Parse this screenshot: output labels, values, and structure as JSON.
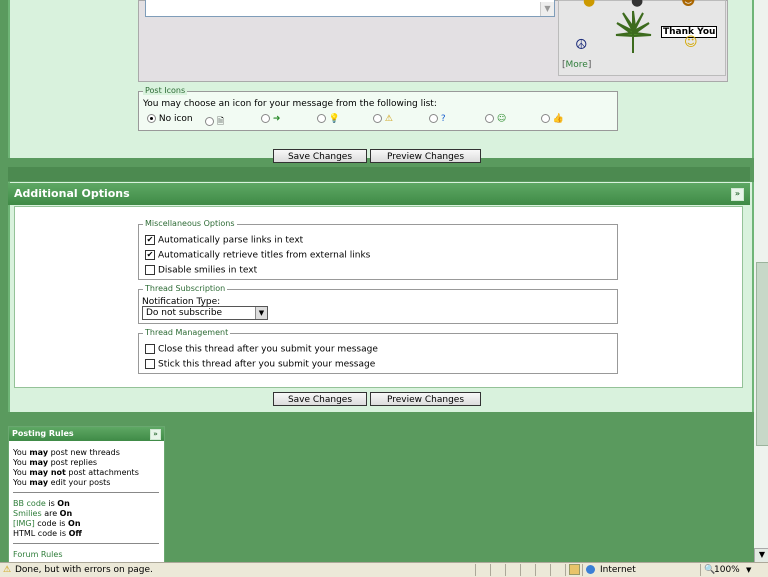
{
  "editor": {
    "textarea_scroll_glyph": "▼",
    "smilies": {
      "thank_you_label": "Thank You",
      "more_link": "More",
      "more_open": "[",
      "more_close": "]"
    }
  },
  "post_icons": {
    "legend": "Post Icons",
    "instruction": "You may choose an icon for your message from the following list:",
    "no_icon_label": "No icon",
    "icons": [
      "doc-icon",
      "arrow-right-icon",
      "lightbulb-icon",
      "warning-icon",
      "question-icon",
      "smile-icon",
      "thumbs-up-icon"
    ]
  },
  "buttons": {
    "save_changes": "Save Changes",
    "preview_changes": "Preview Changes"
  },
  "additional_options": {
    "title": "Additional Options",
    "collapse_glyph": "»",
    "misc": {
      "legend": "Miscellaneous Options",
      "parse_links": {
        "label": "Automatically parse links in text",
        "checked": true
      },
      "retrieve_titles": {
        "label": "Automatically retrieve titles from external links",
        "checked": true
      },
      "disable_smilies": {
        "label": "Disable smilies in text",
        "checked": false
      }
    },
    "subscription": {
      "legend": "Thread Subscription",
      "notification_label": "Notification Type:",
      "selected": "Do not subscribe"
    },
    "management": {
      "legend": "Thread Management",
      "close_thread": {
        "label": "Close this thread after you submit your message",
        "checked": false
      },
      "stick_thread": {
        "label": "Stick this thread after you submit your message",
        "checked": false
      }
    },
    "check_glyph": "✔"
  },
  "posting_rules": {
    "title": "Posting Rules",
    "collapse_glyph": "»",
    "you": "You",
    "may": "may",
    "may_not": "may not",
    "new_threads": "post new threads",
    "replies": "post replies",
    "attachments": "post attachments",
    "edit_posts": "edit your posts",
    "bb_code": "BB code",
    "smilies": "Smilies",
    "img": "[IMG]",
    "html": "HTML code",
    "is": "is",
    "are": "are",
    "code_is": "code is",
    "on": "On",
    "off": "Off",
    "forum_rules": "Forum Rules"
  },
  "status_bar": {
    "message": "Done, but with errors on page.",
    "zone": "Internet",
    "zoom": "100%",
    "warning_glyph": "⚠",
    "zoom_glyph": "▼"
  },
  "colors": {
    "accent": "#3f8a46",
    "panel_bg": "#d9f2dd",
    "page_bg": "#5a9a5e"
  }
}
